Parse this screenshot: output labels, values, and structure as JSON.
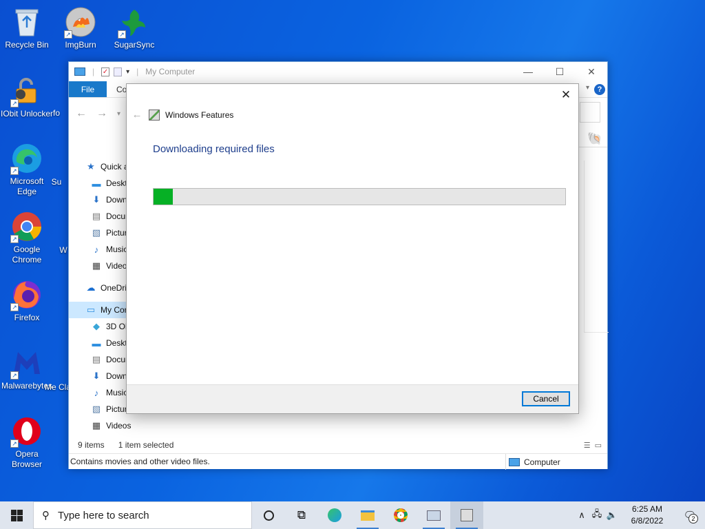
{
  "desktop": {
    "icons": [
      {
        "label": "Recycle Bin",
        "icon": "recycle-bin-icon"
      },
      {
        "label": "ImgBurn",
        "icon": "imgburn-icon"
      },
      {
        "label": "SugarSync",
        "icon": "sugarsync-icon"
      },
      {
        "label": "IObit Unlocker",
        "icon": "iobit-unlocker-icon"
      },
      {
        "label": "Microsoft Edge",
        "icon": "edge-icon"
      },
      {
        "label": "Google Chrome",
        "icon": "chrome-icon"
      },
      {
        "label": "Firefox",
        "icon": "firefox-icon"
      },
      {
        "label": "Malwarebytes",
        "icon": "malwarebytes-icon"
      },
      {
        "label": "Opera Browser",
        "icon": "opera-icon"
      }
    ],
    "partial_labels": [
      "fo",
      "Su",
      "W",
      "Me Cla"
    ]
  },
  "explorer": {
    "title": "My Computer",
    "ribbon_tabs": [
      "File",
      "Co"
    ],
    "nav_items": [
      {
        "label": "Quick a",
        "level": 1,
        "icon": "star-icon"
      },
      {
        "label": "Deskto",
        "level": 2,
        "icon": "desktop-folder-icon"
      },
      {
        "label": "Down",
        "level": 2,
        "icon": "downloads-icon"
      },
      {
        "label": "Docun",
        "level": 2,
        "icon": "documents-icon"
      },
      {
        "label": "Pictur",
        "level": 2,
        "icon": "pictures-icon"
      },
      {
        "label": "Music",
        "level": 2,
        "icon": "music-icon"
      },
      {
        "label": "Videos",
        "level": 2,
        "icon": "videos-icon"
      },
      {
        "label": "OneDriv",
        "level": 1,
        "icon": "onedrive-icon"
      },
      {
        "label": "My Cor",
        "level": 1,
        "icon": "computer-icon",
        "selected": true
      },
      {
        "label": "3D Ob",
        "level": 2,
        "icon": "3d-objects-icon"
      },
      {
        "label": "Deskto",
        "level": 2,
        "icon": "desktop-folder-icon"
      },
      {
        "label": "Docun",
        "level": 2,
        "icon": "documents-icon"
      },
      {
        "label": "Down",
        "level": 2,
        "icon": "downloads-icon"
      },
      {
        "label": "Music",
        "level": 2,
        "icon": "music-icon"
      },
      {
        "label": "Pictur",
        "level": 2,
        "icon": "pictures-icon"
      },
      {
        "label": "Videos",
        "level": 2,
        "icon": "videos-icon"
      }
    ],
    "status": {
      "item_count": "9 items",
      "selection": "1 item selected"
    },
    "info_bar": {
      "description": "Contains movies and other video files.",
      "location": "Computer"
    }
  },
  "dialog": {
    "title": "Windows Features",
    "heading": "Downloading required files",
    "progress_fraction": 0.047,
    "progress_color": "#06b025",
    "cancel_label": "Cancel"
  },
  "taskbar": {
    "search_placeholder": "Type here to search",
    "time": "6:25 AM",
    "date": "6/8/2022",
    "notification_count": "2"
  }
}
